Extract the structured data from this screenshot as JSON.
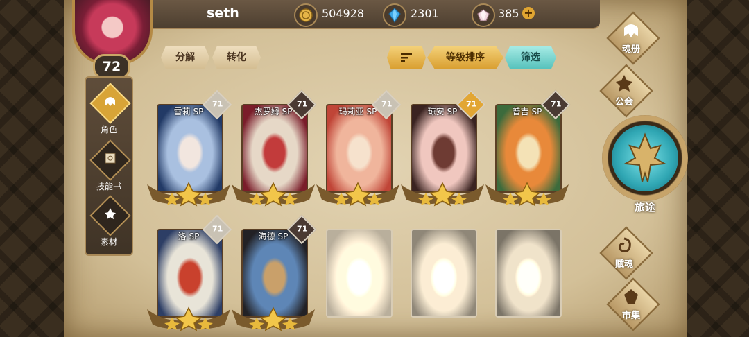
{
  "player": {
    "name": "seth",
    "level": "72"
  },
  "resources": {
    "gold": "504928",
    "crystal": "2301",
    "gem": "385",
    "add_symbol": "+"
  },
  "sidebar": {
    "items": [
      {
        "label": "角色",
        "icon": "helmet-icon",
        "active": true
      },
      {
        "label": "技能书",
        "icon": "skill-book-icon",
        "active": false
      },
      {
        "label": "素材",
        "icon": "material-icon",
        "active": false
      }
    ]
  },
  "toolbar": {
    "decompose": "分解",
    "convert": "转化",
    "sort_level": "等级排序",
    "filter": "筛选",
    "sort_icon": "sort-lines-icon"
  },
  "cards": [
    {
      "name": "雪莉 SP",
      "level": "71",
      "badge_color": "#c9c2b4",
      "art": [
        "#223a66",
        "#a9c0e0",
        "#f2e6df"
      ],
      "locked": false
    },
    {
      "name": "杰罗姆 SP",
      "level": "71",
      "badge_color": "#4a3a33",
      "art": [
        "#7a1d2a",
        "#e6d8c7",
        "#c23b3b"
      ],
      "locked": false
    },
    {
      "name": "玛莉亚 SP",
      "level": "71",
      "badge_color": "#c9c2b4",
      "art": [
        "#c04537",
        "#f0b59c",
        "#f6e2cd"
      ],
      "locked": false
    },
    {
      "name": "琼安 SP",
      "level": "71",
      "badge_color": "#e2a634",
      "art": [
        "#3a2321",
        "#f0c7bf",
        "#6e3b33"
      ],
      "locked": false
    },
    {
      "name": "普吉 SP",
      "level": "71",
      "badge_color": "#4a3a33",
      "art": [
        "#3c6b3c",
        "#e8893a",
        "#f4e2b6"
      ],
      "locked": false
    },
    {
      "name": "洛 SP",
      "level": "71",
      "badge_color": "#c9c2b4",
      "art": [
        "#2d3e65",
        "#e8e4d8",
        "#c9412d"
      ],
      "locked": false
    },
    {
      "name": "海德 SP",
      "level": "71",
      "badge_color": "#4a3a33",
      "art": [
        "#222125",
        "#5e86b6",
        "#c9a06a"
      ],
      "locked": false
    },
    {
      "name": "",
      "level": "",
      "badge_color": "",
      "art": [
        "#8e7f66",
        "#c8b796",
        "#e8dcc4"
      ],
      "locked": true
    },
    {
      "name": "",
      "level": "",
      "badge_color": "",
      "art": [
        "#6e624e",
        "#bcae8f",
        "#e0d3b8"
      ],
      "locked": true
    },
    {
      "name": "",
      "level": "",
      "badge_color": "",
      "art": [
        "#5f5443",
        "#b4a687",
        "#dccfb2"
      ],
      "locked": true
    }
  ],
  "right_nav": {
    "soul_book": "魂册",
    "guild": "公会",
    "journey": "旅途",
    "talent": "赋魂",
    "market": "市集"
  },
  "colors": {
    "gold_accent": "#d99e2f",
    "teal_accent": "#55c1bb",
    "frame_brown": "#5b4025"
  }
}
